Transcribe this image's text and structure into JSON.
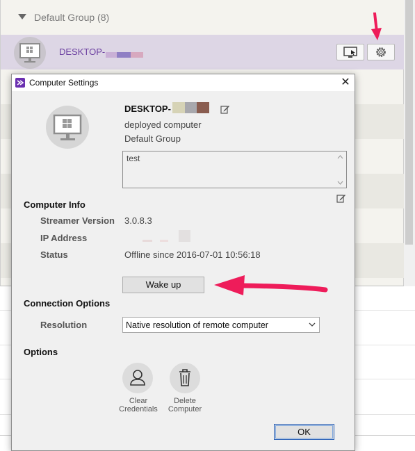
{
  "background_list": {
    "group_title": "Default Group (8)",
    "selected_row": {
      "name": "DESKTOP-"
    }
  },
  "dialog": {
    "title": "Computer Settings",
    "computer_name": "DESKTOP-",
    "subtitle": "deployed computer",
    "group": "Default Group",
    "notes_value": "test",
    "computer_info": {
      "heading": "Computer Info",
      "streamer_version_label": "Streamer Version",
      "streamer_version_value": "3.0.8.3",
      "ip_address_label": "IP Address",
      "status_label": "Status",
      "status_value": "Offline since 2016-07-01 10:56:18"
    },
    "wake_up_label": "Wake up",
    "connection_options": {
      "heading": "Connection Options",
      "resolution_label": "Resolution",
      "resolution_value": "Native resolution of remote computer"
    },
    "options": {
      "heading": "Options",
      "clear_credentials_line1": "Clear",
      "clear_credentials_line2": "Credentials",
      "delete_computer_line1": "Delete",
      "delete_computer_line2": "Computer"
    },
    "ok_label": "OK"
  },
  "colors": {
    "accent_purple": "#6a2fb0",
    "selected_row": "#ddd6e5",
    "annotation_arrow": "#ee1c5a"
  },
  "icons": [
    "windows-monitor-icon",
    "remote-screen-icon",
    "gear-icon",
    "edit-icon",
    "close-icon",
    "user-icon",
    "trash-icon",
    "dropdown-arrow-icon"
  ]
}
